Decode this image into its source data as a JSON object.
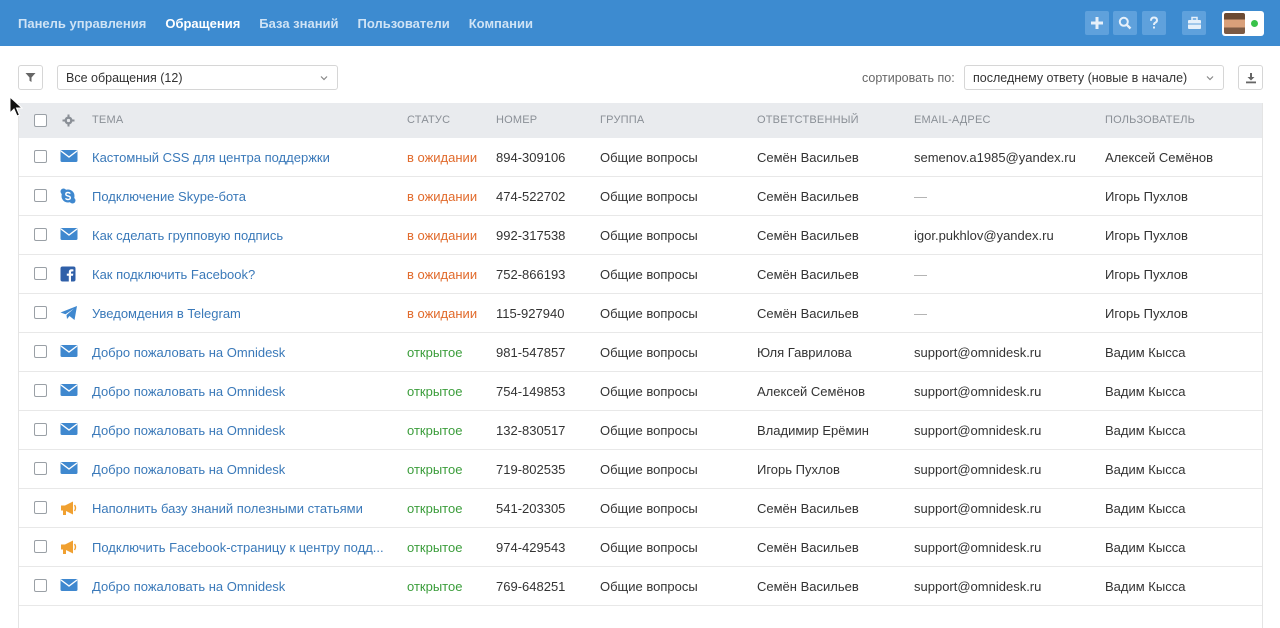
{
  "nav": {
    "items": [
      "Панель управления",
      "Обращения",
      "База знаний",
      "Пользователи",
      "Компании"
    ],
    "active": 1
  },
  "toolbar": {
    "view_select": "Все обращения (12)",
    "sort_label": "сортировать по:",
    "sort_select": "последнему ответу (новые в начале)"
  },
  "table": {
    "headers": {
      "subject": "Тема",
      "status": "Статус",
      "number": "Номер",
      "group": "Группа",
      "assignee": "Ответственный",
      "email": "Email-адрес",
      "user": "Пользователь"
    },
    "rows": [
      {
        "channel": "email-icon",
        "subject": "Кастомный CSS для центра поддержки",
        "status": "в ожидании",
        "status_type": "wait",
        "number": "894-309106",
        "group": "Общие вопросы",
        "assignee": "Семён Васильев",
        "email": "semenov.a1985@yandex.ru",
        "user": "Алексей Семёнов"
      },
      {
        "channel": "skype-icon",
        "subject": "Подключение Skype-бота",
        "status": "в ожидании",
        "status_type": "wait",
        "number": "474-522702",
        "group": "Общие вопросы",
        "assignee": "Семён Васильев",
        "email": "—",
        "user": "Игорь Пухлов"
      },
      {
        "channel": "email-icon",
        "subject": "Как сделать групповую подпись",
        "status": "в ожидании",
        "status_type": "wait",
        "number": "992-317538",
        "group": "Общие вопросы",
        "assignee": "Семён Васильев",
        "email": "igor.pukhlov@yandex.ru",
        "user": "Игорь Пухлов"
      },
      {
        "channel": "facebook-icon",
        "subject": "Как подключить Facebook?",
        "status": "в ожидании",
        "status_type": "wait",
        "number": "752-866193",
        "group": "Общие вопросы",
        "assignee": "Семён Васильев",
        "email": "—",
        "user": "Игорь Пухлов"
      },
      {
        "channel": "telegram-icon",
        "subject": "Уведомдения в Telegram",
        "status": "в ожидании",
        "status_type": "wait",
        "number": "115-927940",
        "group": "Общие вопросы",
        "assignee": "Семён Васильев",
        "email": "—",
        "user": "Игорь Пухлов"
      },
      {
        "channel": "email-icon",
        "subject": "Добро пожаловать на Omnidesk",
        "status": "открытое",
        "status_type": "open",
        "number": "981-547857",
        "group": "Общие вопросы",
        "assignee": "Юля Гаврилова",
        "email": "support@omnidesk.ru",
        "user": "Вадим Кысса"
      },
      {
        "channel": "email-icon",
        "subject": "Добро пожаловать на Omnidesk",
        "status": "открытое",
        "status_type": "open",
        "number": "754-149853",
        "group": "Общие вопросы",
        "assignee": "Алексей Семёнов",
        "email": "support@omnidesk.ru",
        "user": "Вадим Кысса"
      },
      {
        "channel": "email-icon",
        "subject": "Добро пожаловать на Omnidesk",
        "status": "открытое",
        "status_type": "open",
        "number": "132-830517",
        "group": "Общие вопросы",
        "assignee": "Владимир Ерёмин",
        "email": "support@omnidesk.ru",
        "user": "Вадим Кысса"
      },
      {
        "channel": "email-icon",
        "subject": "Добро пожаловать на Omnidesk",
        "status": "открытое",
        "status_type": "open",
        "number": "719-802535",
        "group": "Общие вопросы",
        "assignee": "Игорь Пухлов",
        "email": "support@omnidesk.ru",
        "user": "Вадим Кысса"
      },
      {
        "channel": "megaphone-icon",
        "subject": "Наполнить базу знаний полезными статьями",
        "status": "открытое",
        "status_type": "open",
        "number": "541-203305",
        "group": "Общие вопросы",
        "assignee": "Семён Васильев",
        "email": "support@omnidesk.ru",
        "user": "Вадим Кысса"
      },
      {
        "channel": "megaphone-icon",
        "subject": "Подключить Facebook-страницу к центру подд...",
        "status": "открытое",
        "status_type": "open",
        "number": "974-429543",
        "group": "Общие вопросы",
        "assignee": "Семён Васильев",
        "email": "support@omnidesk.ru",
        "user": "Вадим Кысса"
      },
      {
        "channel": "email-icon",
        "subject": "Добро пожаловать на Omnidesk",
        "status": "открытое",
        "status_type": "open",
        "number": "769-648251",
        "group": "Общие вопросы",
        "assignee": "Семён Васильев",
        "email": "support@omnidesk.ru",
        "user": "Вадим Кысса"
      }
    ]
  },
  "colors": {
    "topbar": "#3d8bd0",
    "link": "#3a79b9",
    "status_wait": "#e16a2b",
    "status_open": "#3b9d3b",
    "icon_blue": "#3f88cf",
    "icon_orange": "#f0a030"
  }
}
